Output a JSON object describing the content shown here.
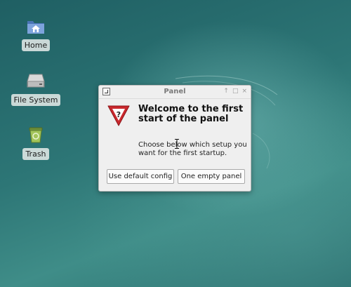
{
  "desktop": {
    "icons": [
      {
        "label": "Home",
        "icon": "home-folder-icon"
      },
      {
        "label": "File System",
        "icon": "drive-icon"
      },
      {
        "label": "Trash",
        "icon": "trash-icon"
      }
    ]
  },
  "dialog": {
    "title": "Panel",
    "heading": "Welcome to the first start of the panel",
    "description": "Choose below which setup you want for the first startup.",
    "buttons": {
      "default_config": "Use default config",
      "empty_panel": "One empty panel"
    },
    "titlebar_controls": [
      "↑",
      "□",
      "×"
    ]
  },
  "colors": {
    "desktop_bg": "#2d7676",
    "warning_red": "#c9282d",
    "dialog_bg": "#efefef"
  }
}
